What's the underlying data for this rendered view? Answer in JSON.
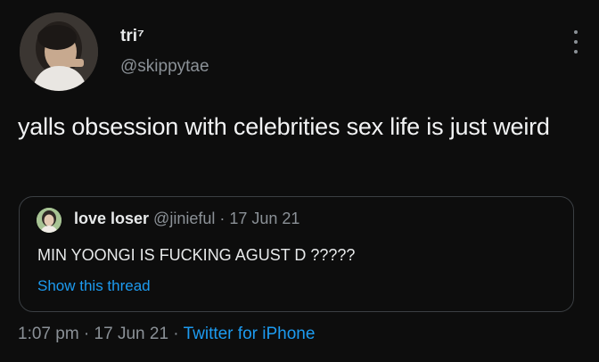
{
  "author": {
    "display_name": "tri⁷",
    "handle": "@skippytae"
  },
  "tweet": {
    "text": "yalls obsession with celebrities sex life is just weird"
  },
  "quoted": {
    "display_name": "love loser",
    "meta": " @jinieful · 17 Jun 21",
    "text": "MIN YOONGI IS FUCKING AGUST D ?????",
    "show_thread_label": "Show this thread"
  },
  "footer": {
    "time": "1:07 pm",
    "sep1": " · ",
    "date": "17 Jun 21",
    "sep2": " · ",
    "source": "Twitter for iPhone"
  },
  "colors": {
    "background": "#0d0d0d",
    "accent": "#1d9bf0",
    "secondary_text": "#8b9197"
  },
  "icons": {
    "more": "more-options-icon"
  }
}
